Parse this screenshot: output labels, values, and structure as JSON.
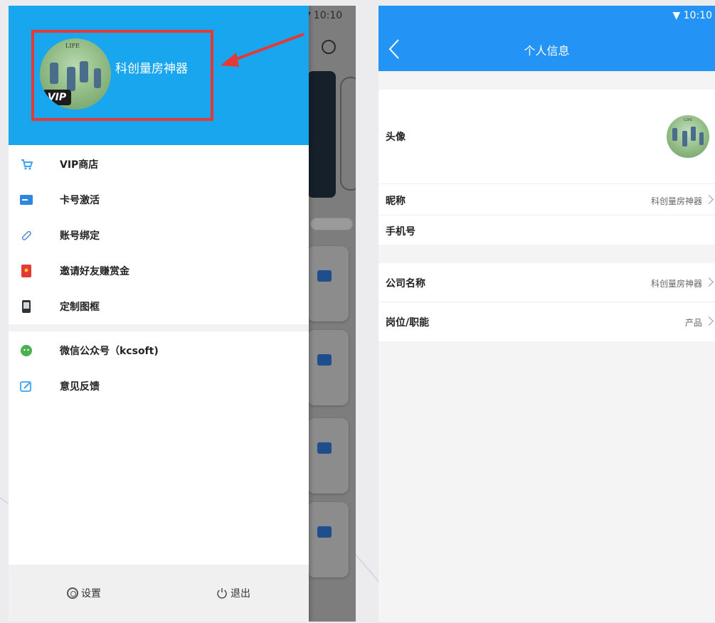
{
  "left_screen": {
    "status_time": "10:10",
    "drawer": {
      "nickname": "科创量房神器",
      "vip_badge": "VIP",
      "avatar_text": "LIFE",
      "menu_group_1": [
        {
          "label": "VIP商店",
          "icon": "shopping-cart-icon",
          "color": "#3aa3f2"
        },
        {
          "label": "卡号激活",
          "icon": "card-icon",
          "color": "#2e86de"
        },
        {
          "label": "账号绑定",
          "icon": "link-icon",
          "color": "#5b8fd6"
        },
        {
          "label": "邀请好友赚赏金",
          "icon": "red-envelope-icon",
          "color": "#e53935"
        },
        {
          "label": "定制图框",
          "icon": "phone-frame-icon",
          "color": "#333333"
        }
      ],
      "menu_group_2": [
        {
          "label": "微信公众号（kcsoft)",
          "icon": "wechat-icon",
          "color": "#4caf50"
        },
        {
          "label": "意见反馈",
          "icon": "feedback-icon",
          "color": "#3aa3f2"
        }
      ],
      "footer": {
        "settings_label": "设置",
        "logout_label": "退出"
      }
    },
    "highlight_color": "#e53935"
  },
  "right_screen": {
    "status_time": "10:10",
    "title": "个人信息",
    "avatar_label": "头像",
    "avatar_text": "LIFE",
    "rows_group_1": [
      {
        "label": "昵称",
        "value": "科创量房神器",
        "chevron": true
      },
      {
        "label": "手机号",
        "value": "",
        "chevron": false
      }
    ],
    "rows_group_2": [
      {
        "label": "公司名称",
        "value": "科创量房神器",
        "chevron": true
      },
      {
        "label": "岗位/职能",
        "value": "产品",
        "chevron": true
      }
    ]
  },
  "colors": {
    "drawer_header": "#18a6ee",
    "nav_bar": "#2393f6"
  }
}
